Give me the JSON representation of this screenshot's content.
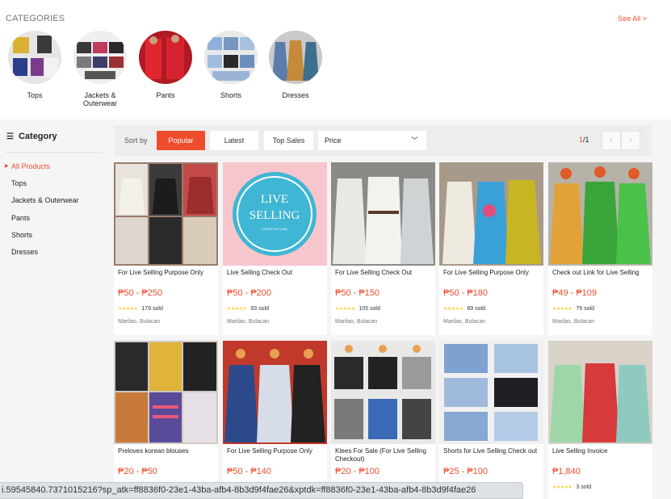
{
  "categories": {
    "title": "CATEGORIES",
    "see_all": "See All >",
    "items": [
      {
        "label": "Tops"
      },
      {
        "label": "Jackets & Outerwear"
      },
      {
        "label": "Pants"
      },
      {
        "label": "Shorts"
      },
      {
        "label": "Dresses"
      }
    ]
  },
  "sidebar": {
    "title": "Category",
    "items": [
      {
        "label": "All Products",
        "active": true
      },
      {
        "label": "Tops"
      },
      {
        "label": "Jackets & Outerwear"
      },
      {
        "label": "Pants"
      },
      {
        "label": "Shorts"
      },
      {
        "label": "Dresses"
      }
    ]
  },
  "sortbar": {
    "label": "Sort by",
    "options": [
      "Popular",
      "Latest",
      "Top Sales"
    ],
    "active": "Popular",
    "price_label": "Price",
    "page_current": "1",
    "page_total": "/1"
  },
  "products": [
    {
      "name": "For Live Selling Purpose Only",
      "price": "₱50 - ₱250",
      "sold": "179 sold",
      "location": "Marilao, Bulacan"
    },
    {
      "name": "Live Selling Check Out",
      "price": "₱50 - ₱200",
      "sold": "93 sold",
      "location": "Marilao, Bulacan",
      "image_text": [
        "LIVE",
        "SELLING",
        "CHECKOUT LINK"
      ]
    },
    {
      "name": "For Live Selling Check Out",
      "price": "₱50 - ₱150",
      "sold": "105 sold",
      "location": "Marilao, Bulacan"
    },
    {
      "name": "For Live Selling Purpose Only",
      "price": "₱50 - ₱180",
      "sold": "89 sold",
      "location": "Marilao, Bulacan"
    },
    {
      "name": "Check out Link for Live Selling",
      "price": "₱49 - ₱109",
      "sold": "79 sold",
      "location": "Marilao, Bulacan"
    },
    {
      "name": "Preloves korean blouses",
      "price": "₱20 - ₱50",
      "sold": "",
      "location": ""
    },
    {
      "name": "For Live Selling Purpose Only",
      "price": "₱50 - ₱140",
      "sold": "",
      "location": ""
    },
    {
      "name": "Ktees For Sale (For Live Selling Checkout)",
      "price": "₱20 - ₱100",
      "sold": "",
      "location": ""
    },
    {
      "name": "Shorts for Live Selling Check out",
      "price": "₱25 - ₱100",
      "sold": "",
      "location": ""
    },
    {
      "name": "Live Selling Invoice",
      "price": "₱1,840",
      "sold": "3 sold",
      "location": ""
    }
  ],
  "rating_stars": "★★★★★",
  "status_url": "i.59545840.7371015216?sp_atk=ff8836f0-23e1-43ba-afb4-8b3d9f4fae26&xptdk=ff8836f0-23e1-43ba-afb4-8b3d9f4fae26",
  "colors": {
    "accent": "#ee4d2d",
    "star": "#ffce3d",
    "live_bg": "#f7c6cc",
    "live_badge": "#3fb6d4"
  }
}
